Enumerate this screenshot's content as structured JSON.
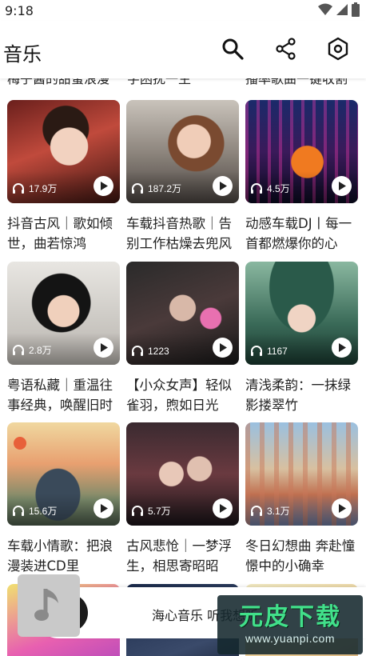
{
  "status_bar": {
    "time": "9:18",
    "icons": [
      "wifi-icon",
      "cell-signal-icon",
      "battery-icon"
    ]
  },
  "app_bar": {
    "title": "音乐",
    "actions": [
      {
        "name": "search-button",
        "icon": "search-icon"
      },
      {
        "name": "share-button",
        "icon": "share-icon"
      },
      {
        "name": "settings-button",
        "icon": "hexagon-settings-icon"
      }
    ]
  },
  "partial_row_titles": [
    "梅子酱的甜蜜浪漫",
    "字困扰一生",
    "播率歌曲一键收割"
  ],
  "playlists": [
    {
      "title": "抖音古风｜歌如倾世，曲若惊鸿",
      "plays": "17.9万"
    },
    {
      "title": "车载抖音热歌｜告别工作枯燥去兜风",
      "plays": "187.2万"
    },
    {
      "title": "动感车载DJ丨每一首都燃爆你的心",
      "plays": "4.5万"
    },
    {
      "title": "粤语私藏｜重温往事经典，唤醒旧时",
      "plays": "2.8万"
    },
    {
      "title": "【小众女声】轻似雀羽，煦如日光",
      "plays": "1223"
    },
    {
      "title": "清浅柔韵：一抹绿影搂翠竹",
      "plays": "1167"
    },
    {
      "title": "车载小情歌：把浪漫装进CD里",
      "plays": "15.6万"
    },
    {
      "title": "古风悲怆｜一梦浮生，相思寄昭昭",
      "plays": "5.7万"
    },
    {
      "title": "冬日幻想曲 奔赴憧憬中的小确幸",
      "plays": "3.1万"
    }
  ],
  "mini_player": {
    "title": "海心音乐 听我想听"
  },
  "watermark": {
    "main": "元皮下载",
    "sub": "www.yuanpi.com"
  }
}
